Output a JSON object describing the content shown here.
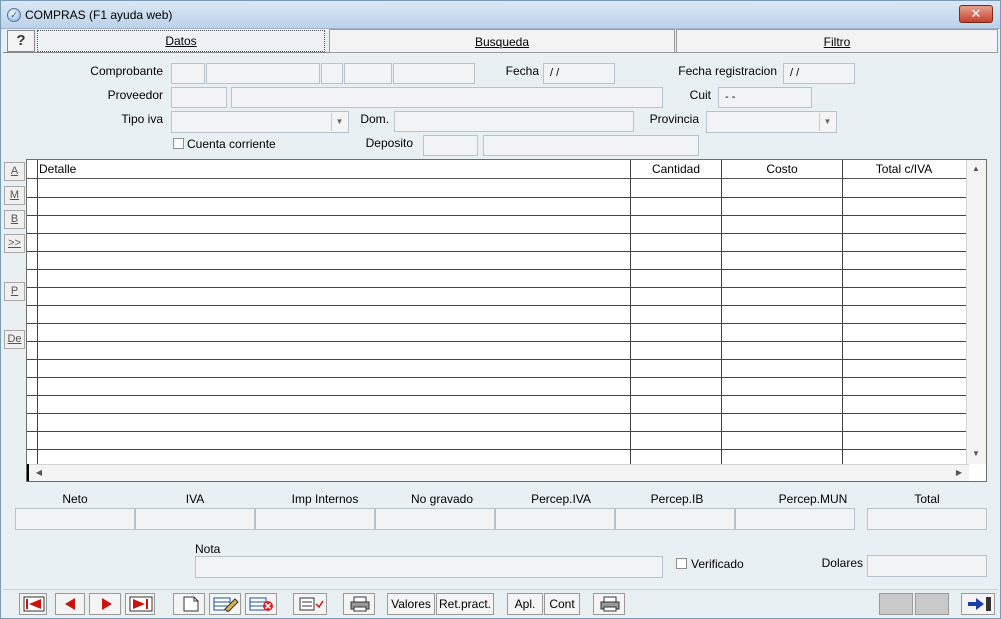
{
  "window": {
    "title": "COMPRAS (F1 ayuda web)",
    "close_glyph": "✕"
  },
  "tabs": [
    {
      "label": "Datos",
      "active": true
    },
    {
      "label": "Busqueda",
      "active": false
    },
    {
      "label": "Filtro",
      "active": false
    }
  ],
  "help_button": {
    "glyph": "?"
  },
  "form": {
    "comprobante_label": "Comprobante",
    "fecha_label": "Fecha",
    "fecha_value": " / /",
    "fecha_registracion_label": "Fecha registracion",
    "fecha_registracion_value": " / /",
    "proveedor_label": "Proveedor",
    "cuit_label": "Cuit",
    "cuit_value": "-      -",
    "tipo_iva_label": "Tipo iva",
    "dom_label": "Dom.",
    "provincia_label": "Provincia",
    "cuenta_corriente_label": "Cuenta corriente",
    "deposito_label": "Deposito"
  },
  "side_buttons": [
    "A",
    "M",
    "B",
    ">>",
    "P",
    "De"
  ],
  "grid": {
    "columns": [
      "Detalle",
      "Cantidad",
      "Costo",
      "Total c/IVA"
    ],
    "row_count": 16
  },
  "totals": {
    "labels": [
      "Neto",
      "IVA",
      "Imp Internos",
      "No gravado",
      "Percep.IVA",
      "Percep.IB",
      "Percep.MUN",
      "Total"
    ]
  },
  "footer": {
    "nota_label": "Nota",
    "verificado_label": "Verificado",
    "dolares_label": "Dolares"
  },
  "toolbar": {
    "valores_label": "Valores",
    "ret_pract_label": "Ret.pract.",
    "apl_label": "Apl.",
    "cont_label": "Cont"
  },
  "colors": {
    "titlebar": "#bcd2ea",
    "close": "#c4412a",
    "nav_red": "#cc1111",
    "grid_line": "#444444"
  }
}
